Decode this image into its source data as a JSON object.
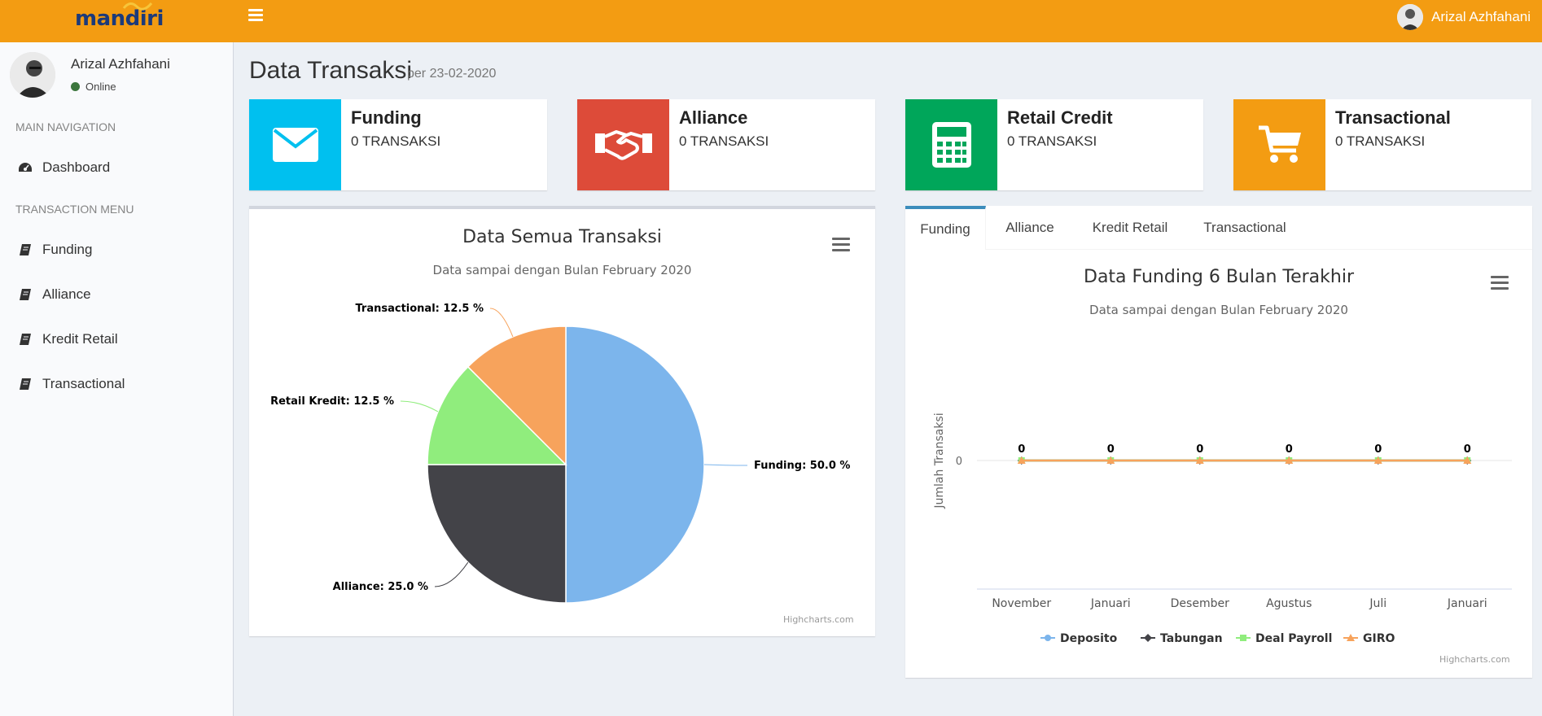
{
  "header": {
    "logo_text": "mandiri",
    "user_name": "Arizal Azhfahani"
  },
  "sidebar": {
    "user_name": "Arizal Azhfahani",
    "status": "Online",
    "main_header": "MAIN NAVIGATION",
    "transaction_header": "TRANSACTION MENU",
    "items": [
      {
        "label": "Dashboard",
        "icon": "dashboard-icon"
      },
      {
        "label": "Funding",
        "icon": "book-icon"
      },
      {
        "label": "Alliance",
        "icon": "book-icon"
      },
      {
        "label": "Kredit Retail",
        "icon": "book-icon"
      },
      {
        "label": "Transactional",
        "icon": "book-icon"
      }
    ]
  },
  "page": {
    "title": "Data Transaksi",
    "subtitle": "per 23-02-2020"
  },
  "info_boxes": [
    {
      "title": "Funding",
      "value": "0 TRANSAKSI",
      "icon": "envelope-icon",
      "color": "#00c0ef"
    },
    {
      "title": "Alliance",
      "value": "0 TRANSAKSI",
      "icon": "handshake-icon",
      "color": "#dd4b39"
    },
    {
      "title": "Retail Credit",
      "value": "0 TRANSAKSI",
      "icon": "calculator-icon",
      "color": "#00a65a"
    },
    {
      "title": "Transactional",
      "value": "0 TRANSAKSI",
      "icon": "cart-icon",
      "color": "#f39c12"
    }
  ],
  "pie_panel": {
    "title": "Data Semua Transaksi",
    "subtitle": "Data sampai dengan Bulan February 2020",
    "credits": "Highcharts.com"
  },
  "line_panel": {
    "tabs": [
      "Funding",
      "Alliance",
      "Kredit Retail",
      "Transactional"
    ],
    "active_tab": 0,
    "title": "Data Funding 6 Bulan Terakhir",
    "subtitle": "Data sampai dengan Bulan February 2020",
    "credits": "Highcharts.com"
  },
  "chart_data": [
    {
      "type": "pie",
      "title": "Data Semua Transaksi",
      "subtitle": "Data sampai dengan Bulan February 2020",
      "slices": [
        {
          "name": "Funding",
          "value": 50.0,
          "label": "Funding: 50.0 %",
          "color": "#7cb5ec"
        },
        {
          "name": "Alliance",
          "value": 25.0,
          "label": "Alliance: 25.0 %",
          "color": "#434348"
        },
        {
          "name": "Retail Kredit",
          "value": 12.5,
          "label": "Retail Kredit: 12.5 %",
          "color": "#90ed7d"
        },
        {
          "name": "Transactional",
          "value": 12.5,
          "label": "Transactional: 12.5 %",
          "color": "#f7a35c"
        }
      ]
    },
    {
      "type": "line",
      "title": "Data Funding 6 Bulan Terakhir",
      "subtitle": "Data sampai dengan Bulan February 2020",
      "ylabel": "Jumlah Transaksi",
      "yticks": [
        "0"
      ],
      "categories": [
        "November",
        "Januari",
        "Desember",
        "Agustus",
        "Juli",
        "Januari"
      ],
      "series": [
        {
          "name": "Deposito",
          "values": [
            0,
            0,
            0,
            0,
            0,
            0
          ],
          "color": "#7cb5ec",
          "marker": "circle"
        },
        {
          "name": "Tabungan",
          "values": [
            0,
            0,
            0,
            0,
            0,
            0
          ],
          "color": "#434348",
          "marker": "diamond"
        },
        {
          "name": "Deal Payroll",
          "values": [
            0,
            0,
            0,
            0,
            0,
            0
          ],
          "color": "#90ed7d",
          "marker": "square"
        },
        {
          "name": "GIRO",
          "values": [
            0,
            0,
            0,
            0,
            0,
            0
          ],
          "color": "#f7a35c",
          "marker": "triangle"
        }
      ],
      "data_labels": [
        "0",
        "0",
        "0",
        "0",
        "0",
        "0"
      ],
      "legend": "bottom-center"
    }
  ]
}
